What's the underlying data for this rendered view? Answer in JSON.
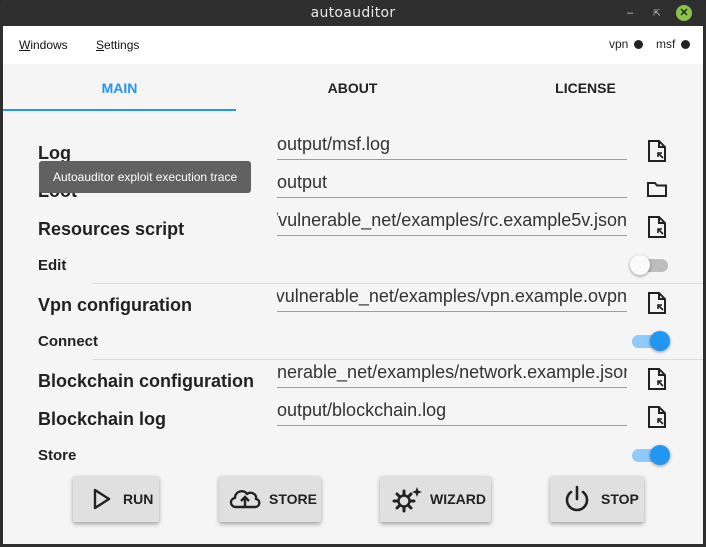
{
  "window": {
    "title": "autoauditor"
  },
  "menubar": {
    "windows": {
      "accel": "W",
      "rest": "indows"
    },
    "settings": {
      "accel": "S",
      "rest": "ettings"
    },
    "status": [
      {
        "label": "vpn"
      },
      {
        "label": "msf"
      }
    ]
  },
  "tabs": [
    {
      "label": "MAIN",
      "active": true
    },
    {
      "label": "ABOUT",
      "active": false
    },
    {
      "label": "LICENSE",
      "active": false
    }
  ],
  "form": {
    "log": {
      "label": "Log",
      "value": "output/msf.log"
    },
    "loot": {
      "label": "Loot",
      "value": "output"
    },
    "resources_script": {
      "label": "Resources script",
      "value": "/vulnerable_net/examples/rc.example5v.json"
    },
    "edit": {
      "label": "Edit",
      "on": false
    },
    "vpn_configuration": {
      "label": "Vpn configuration",
      "value": "/vulnerable_net/examples/vpn.example.ovpn"
    },
    "connect": {
      "label": "Connect",
      "on": true
    },
    "blockchain_configuration": {
      "label": "Blockchain configuration",
      "value": "nerable_net/examples/network.example.json"
    },
    "blockchain_log": {
      "label": "Blockchain log",
      "value": "output/blockchain.log"
    },
    "store": {
      "label": "Store",
      "on": true
    }
  },
  "tooltip": {
    "text": "Autoauditor exploit execution trace"
  },
  "actions": {
    "run": "RUN",
    "store": "STORE",
    "wizard": "WIZARD",
    "stop": "STOP"
  },
  "icons": {
    "file": "file-open-icon",
    "folder": "folder-icon",
    "run": "play-icon",
    "store": "cloud-upload-icon",
    "wizard": "gear-sparkle-icon",
    "stop": "power-icon"
  },
  "colors": {
    "accent": "#2196f3",
    "toggle_track_on": "#90caf9",
    "titlebar": "#2f2f2f",
    "close": "#8bc34a"
  }
}
